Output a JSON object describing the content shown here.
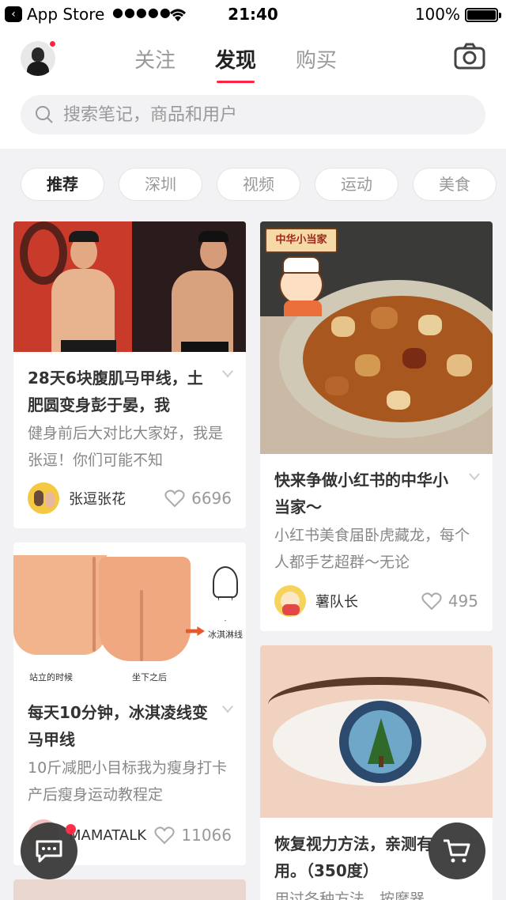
{
  "status_bar": {
    "back_label": "App Store",
    "signal": "●●●●●",
    "time": "21:40",
    "battery": "100%"
  },
  "header": {
    "tabs": [
      {
        "label": "关注",
        "active": false
      },
      {
        "label": "发现",
        "active": true
      },
      {
        "label": "购买",
        "active": false
      }
    ],
    "search_placeholder": "搜索笔记，商品和用户"
  },
  "categories": [
    "推荐",
    "深圳",
    "视频",
    "运动",
    "美食"
  ],
  "feed": [
    {
      "title": "28天6块腹肌马甲线，土肥圆变身彭于晏，我",
      "description": "健身前后大对比大家好，我是张逗！你们可能不知",
      "author": "张逗张花",
      "likes": "6696"
    },
    {
      "title": "快来争做小红书的中华小当家～",
      "description": "小红书美食届卧虎藏龙，每个人都手艺超群～无论",
      "author": "薯队长",
      "likes": "495",
      "image_caption": "中华小当家"
    },
    {
      "title": "每天10分钟，冰淇凌线变马甲线",
      "description": "10斤减肥小目标我为瘦身打卡产后瘦身运动教程定",
      "author": "MAMATALK",
      "likes": "11066",
      "image_labels": [
        "站立的时候",
        "坐下之后",
        "冰淇淋线"
      ]
    },
    {
      "title": "恢复视力方法，亲测有用。（350度）",
      "description": "用过各种方法，按摩器"
    }
  ],
  "colors": {
    "accent": "#ff2442",
    "background": "#f2f2f4"
  }
}
